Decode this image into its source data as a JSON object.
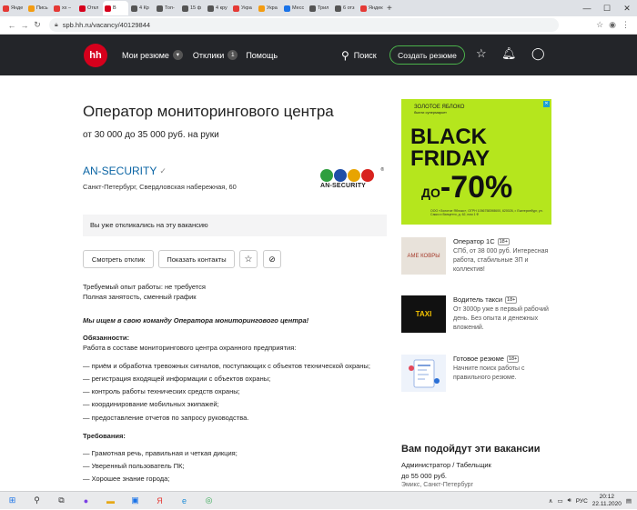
{
  "browser": {
    "tabs": [
      {
        "label": "Янде",
        "color": "#e53935"
      },
      {
        "label": "Пись",
        "color": "#f39c12"
      },
      {
        "label": "хх –",
        "color": "#e53935"
      },
      {
        "label": "Откл",
        "color": "#d6001c"
      },
      {
        "label": "В",
        "color": "#d6001c"
      },
      {
        "label": "4 Кр",
        "color": "#555"
      },
      {
        "label": "Топ-",
        "color": "#555"
      },
      {
        "label": "15 ф",
        "color": "#555"
      },
      {
        "label": "4 кру",
        "color": "#555"
      },
      {
        "label": "Укра",
        "color": "#e53935"
      },
      {
        "label": "Укра",
        "color": "#f39c12"
      },
      {
        "label": "Месс",
        "color": "#1a73e8"
      },
      {
        "label": "Трил",
        "color": "#555"
      },
      {
        "label": "6 отз",
        "color": "#555"
      },
      {
        "label": "Яндекс",
        "color": "#e53935"
      }
    ],
    "url": "spb.hh.ru/vacancy/40129844"
  },
  "header": {
    "logo": "hh",
    "my_resumes": "Мои резюме",
    "responses": "Отклики",
    "responses_count": "1",
    "help": "Помощь",
    "search": "Поиск",
    "create_resume": "Создать резюме"
  },
  "vacancy": {
    "title": "Оператор мониторингового центра",
    "salary": "от 30 000 до 35 000 руб. на руки",
    "company": "AN-SECURITY",
    "address": "Санкт-Петербург, Свердловская набережная, 60",
    "logo_text": "AN-SECURITY",
    "notice": "Вы уже откликались на эту вакансию",
    "btn_view_response": "Смотреть отклик",
    "btn_show_contacts": "Показать контакты",
    "experience": "Требуемый опыт работы: не требуется",
    "employment": "Полная занятость, сменный график",
    "intro": "Мы ищем в свою команду Оператора мониторингового центра!",
    "duties_title": "Обязанности:",
    "duties_text": "Работа в составе мониторингового центра охранного предприятия:",
    "duties": [
      "— приём и обработка тревожных сигналов, поступающих с объектов технической охраны;",
      "— регистрация входящей информации с объектов охраны;",
      "— контроль работы технических средств охраны;",
      "— координирование мобильных экипажей;",
      "— предоставление отчетов по запросу руководства."
    ],
    "req_title": "Требования:",
    "reqs": [
      "— Грамотная речь, правильная и четкая дикция;",
      "— Уверенный пользователь ПК;",
      "— Хорошее знание города;"
    ]
  },
  "ad": {
    "brand": "ЗОЛОТОЕ ЯБЛОКО",
    "brand_sub": "бьюти супермаркет",
    "line1": "BLACK",
    "line2": "FRIDAY",
    "prefix": "ДО",
    "percent": "-70%",
    "legal": "ООО «Золотое Яблоко», ОГРН 1056758398600, 620026, г. Екатеринбург, ул. Сакко и Ванцетти, д. 62, пом 1 Ф"
  },
  "sidebar": [
    {
      "title": "Оператор 1С",
      "badge": "18+",
      "img_text": "АМЕ КОВРЫ",
      "img_bg": "#e8e2da",
      "img_color": "#a53a2a",
      "desc": "СПб, от 38 000 руб. Интересная работа, стабильные ЗП и коллектив!"
    },
    {
      "title": "Водитель такси",
      "badge": "18+",
      "img_text": "TAXI",
      "img_bg": "#111111",
      "img_color": "#f5c400",
      "desc": "От 3000р уже в первый рабочий день. Без опыта и денежных вложений."
    },
    {
      "title": "Готовое резюме",
      "badge": "18+",
      "img_text": "",
      "img_bg": "#eef3fb",
      "img_color": "#2a6fd6",
      "desc": "Начните поиск работы с правильного резюме."
    }
  ],
  "suitable": {
    "title": "Вам подойдут эти вакансии",
    "job": "Администратор / Табельщик",
    "salary": "до 55 000 руб.",
    "employer": "Эмикс, Санкт-Петербург"
  },
  "taskbar": {
    "lang": "РУС",
    "time": "20:12",
    "date": "22.11.2020"
  }
}
